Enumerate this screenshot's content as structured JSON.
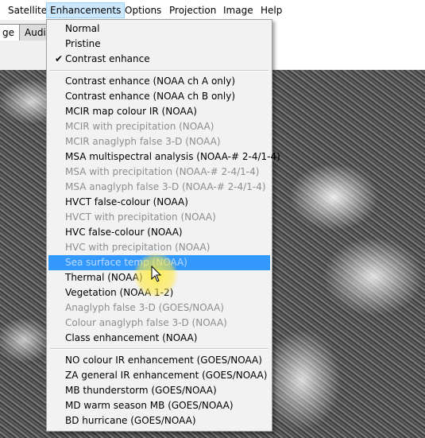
{
  "menubar": {
    "items": [
      "Satellite",
      "Enhancements",
      "Options",
      "Projection",
      "Image",
      "Help"
    ]
  },
  "tabs": [
    "ge",
    "Audio"
  ],
  "menu": {
    "items": [
      {
        "label": "Normal",
        "enabled": true
      },
      {
        "label": "Pristine",
        "enabled": true
      },
      {
        "label": "Contrast enhance",
        "enabled": true,
        "checked": true
      },
      {
        "label": "Contrast enhance (NOAA ch A only)",
        "enabled": true
      },
      {
        "label": "Contrast enhance (NOAA ch B only)",
        "enabled": true
      },
      {
        "label": "MCIR map colour IR (NOAA)",
        "enabled": true
      },
      {
        "label": "MCIR with precipitation (NOAA)",
        "enabled": false
      },
      {
        "label": "MCIR anaglyph false 3-D (NOAA)",
        "enabled": false
      },
      {
        "label": "MSA multispectral analysis (NOAA-# 2-4/1-4)",
        "enabled": true
      },
      {
        "label": "MSA with precipitation (NOAA-# 2-4/1-4)",
        "enabled": false
      },
      {
        "label": "MSA anaglyph false 3-D (NOAA-# 2-4/1-4)",
        "enabled": false
      },
      {
        "label": "HVCT false-colour (NOAA)",
        "enabled": true
      },
      {
        "label": "HVCT with precipitation (NOAA)",
        "enabled": false
      },
      {
        "label": "HVC false-colour (NOAA)",
        "enabled": true
      },
      {
        "label": "HVC with precipitation (NOAA)",
        "enabled": false
      },
      {
        "label": "Sea surface temp (NOAA)",
        "enabled": true,
        "highlighted": true
      },
      {
        "label": "Thermal (NOAA)",
        "enabled": true
      },
      {
        "label": "Vegetation (NOAA 1-2)",
        "enabled": true
      },
      {
        "label": "Anaglyph false 3-D (GOES/NOAA)",
        "enabled": false
      },
      {
        "label": "Colour anaglyph false 3-D (NOAA)",
        "enabled": false
      },
      {
        "label": "Class enhancement (NOAA)",
        "enabled": true
      },
      {
        "label": "NO colour IR enhancement (GOES/NOAA)",
        "enabled": true
      },
      {
        "label": "ZA general IR enhancement (GOES/NOAA)",
        "enabled": true
      },
      {
        "label": "MB thunderstorm (GOES/NOAA)",
        "enabled": true
      },
      {
        "label": "MD warm season MB (GOES/NOAA)",
        "enabled": true
      },
      {
        "label": "BD hurricane (GOES/NOAA)",
        "enabled": true
      }
    ]
  },
  "colors": {
    "highlight": "#3399ff",
    "disabled_text": "#8d8d8d",
    "menubar_active": "#cce8ff"
  }
}
